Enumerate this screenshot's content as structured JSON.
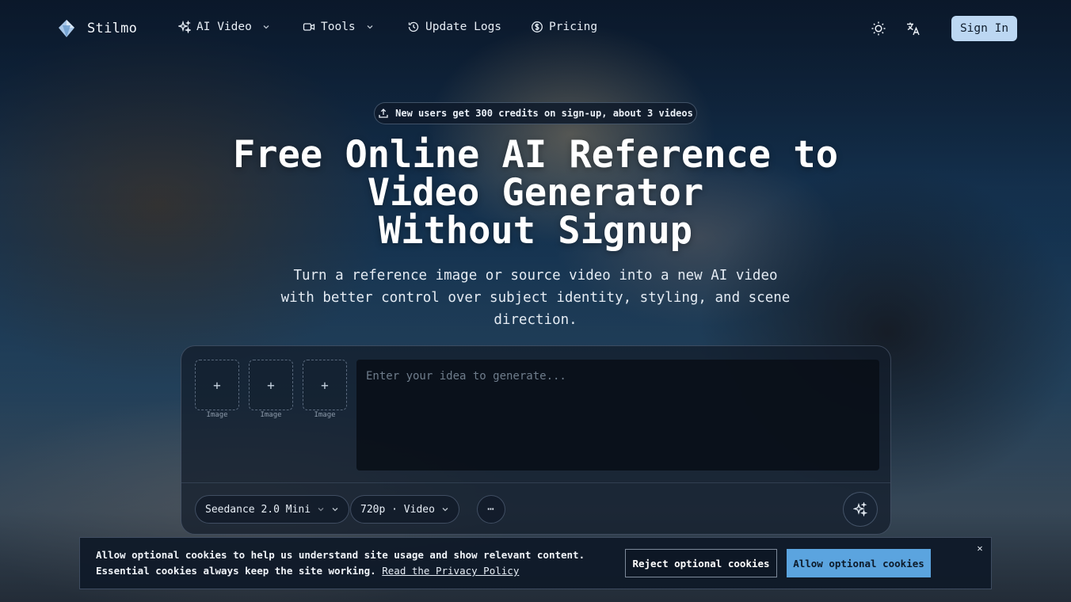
{
  "nav": {
    "brand": "Stilmo",
    "items": [
      {
        "label": "AI Video",
        "icon": "sparkles-icon",
        "has_dropdown": true
      },
      {
        "label": "Tools",
        "icon": "video-camera-icon",
        "has_dropdown": true
      },
      {
        "label": "Update Logs",
        "icon": "history-icon",
        "has_dropdown": false
      },
      {
        "label": "Pricing",
        "icon": "dollar-circle-icon",
        "has_dropdown": false
      }
    ],
    "theme_icon": "sun-icon",
    "language_icon": "translate-icon",
    "sign_in": "Sign In"
  },
  "hero": {
    "promo": "New users get 300 credits on sign-up, about 3 videos",
    "title_lines": [
      "Free Online AI Reference to",
      "Video Generator",
      "Without Signup"
    ],
    "subtitle_lines": [
      "Turn a reference image or source video into a new AI video",
      "with better control over subject identity, styling, and scene",
      "direction."
    ]
  },
  "generator": {
    "slots": [
      {
        "symbol": "+",
        "label": "Image"
      },
      {
        "symbol": "+",
        "label": "Image"
      },
      {
        "symbol": "+",
        "label": "Image"
      }
    ],
    "prompt_placeholder": "Enter your idea to generate...",
    "model": "Seedance 2.0 Mini",
    "format": "720p · Video",
    "more": "⋯"
  },
  "cookie": {
    "text": "Allow optional cookies to help us understand site usage and show relevant content. Essential cookies always keep the site working.",
    "link": "Read the Privacy Policy",
    "reject": "Reject optional cookies",
    "allow": "Allow optional cookies",
    "close": "✕"
  },
  "colors": {
    "sign_in_bg": "#bcd7f2",
    "allow_bg": "#5ba4df",
    "page_bg": "#0d1a2a"
  }
}
